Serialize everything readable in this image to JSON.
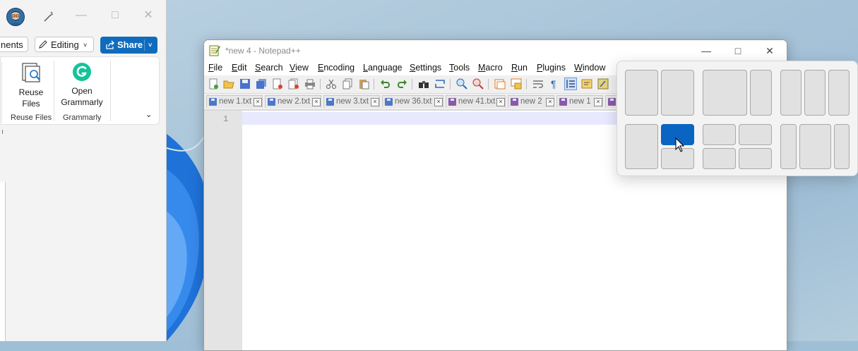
{
  "word": {
    "ribbon": {
      "comments_label": "nents",
      "editing_label": "Editing",
      "share_label": "Share"
    },
    "groups": {
      "reuse_files": {
        "button_line1": "Reuse",
        "button_line2": "Files",
        "label": "Reuse Files"
      },
      "grammarly": {
        "button_line1": "Open",
        "button_line2": "Grammarly",
        "label": "Grammarly"
      }
    }
  },
  "notepad": {
    "title": "*new 4 - Notepad++",
    "menu": [
      {
        "first": "F",
        "rest": "ile"
      },
      {
        "first": "E",
        "rest": "dit"
      },
      {
        "first": "S",
        "rest": "earch"
      },
      {
        "first": "V",
        "rest": "iew"
      },
      {
        "first": "E",
        "rest": "ncoding"
      },
      {
        "first": "L",
        "rest": "anguage"
      },
      {
        "first": "S",
        "rest": "ettings"
      },
      {
        "first": "T",
        "rest": "ools"
      },
      {
        "first": "M",
        "rest": "acro"
      },
      {
        "first": "R",
        "rest": "un"
      },
      {
        "first": "P",
        "rest": "lugins"
      },
      {
        "first": "W",
        "rest": "indow"
      }
    ],
    "tabs": [
      "new 1.txt",
      "new 2.txt",
      "new 3.txt",
      "new 36.txt",
      "new 41.txt",
      "new 2",
      "new 1"
    ],
    "line_number": "1"
  },
  "icons": {
    "word": [
      "avatar",
      "designer-icon",
      "minimize-icon",
      "maximize-icon",
      "close-icon",
      "pencil-icon",
      "share-icon",
      "reuse-files-icon",
      "grammarly-icon",
      "collapse-ribbon-icon"
    ],
    "notepad_toolbar": [
      "new-file-icon",
      "open-file-icon",
      "save-icon",
      "save-all-icon",
      "close-file-icon",
      "close-all-icon",
      "print-icon",
      "cut-icon",
      "copy-icon",
      "paste-icon",
      "undo-icon",
      "redo-icon",
      "find-icon",
      "replace-icon",
      "zoom-in-icon",
      "zoom-out-icon",
      "sync-v-icon",
      "sync-h-icon",
      "wrap-icon",
      "show-all-chars-icon",
      "indent-guide-icon",
      "doc-map-icon",
      "function-list-icon"
    ]
  },
  "colors": {
    "share_button": "#0f6cbd",
    "snap_active_zone": "#0a64c2",
    "current_line": "#e8e8ff"
  }
}
